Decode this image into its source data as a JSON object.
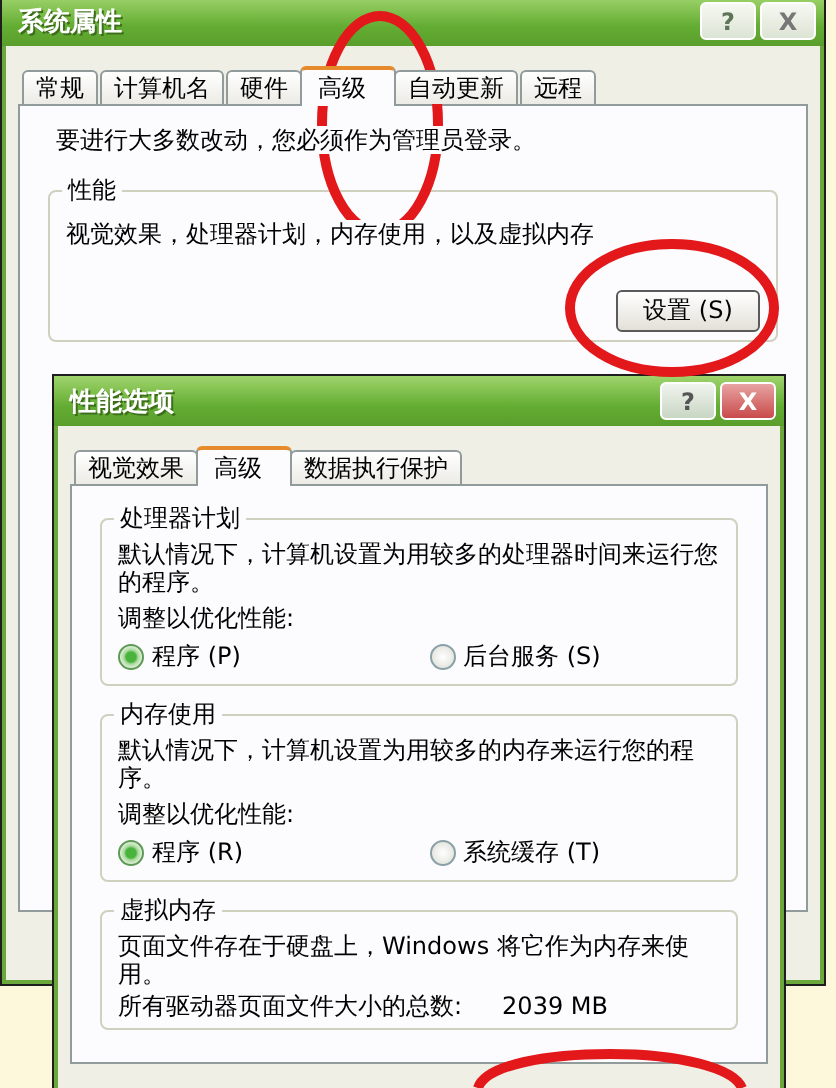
{
  "system_properties": {
    "title": "系统属性",
    "title_buttons": [
      {
        "kind": "help",
        "label": "?"
      },
      {
        "kind": "close",
        "label": "X"
      }
    ],
    "tabs": [
      {
        "label": "常规",
        "selected": false
      },
      {
        "label": "计算机名",
        "selected": false
      },
      {
        "label": "硬件",
        "selected": false
      },
      {
        "label": "高级",
        "selected": true
      },
      {
        "label": "自动更新",
        "selected": false
      },
      {
        "label": "远程",
        "selected": false
      }
    ],
    "notice": "要进行大多数改动，您必须作为管理员登录。",
    "performance": {
      "legend": "性能",
      "description": "视觉效果，处理器计划，内存使用，以及虚拟内存",
      "button": "设置 (S)"
    }
  },
  "performance_options": {
    "title": "性能选项",
    "title_buttons": [
      {
        "kind": "help",
        "label": "?"
      },
      {
        "kind": "close",
        "label": "X"
      }
    ],
    "tabs": [
      {
        "label": "视觉效果",
        "selected": false
      },
      {
        "label": "高级",
        "selected": true
      },
      {
        "label": "数据执行保护",
        "selected": false
      }
    ],
    "groups": [
      {
        "kind": "radios",
        "legend": "处理器计划",
        "description": "默认情况下，计算机设置为用较多的处理器时间来运行您的程序。",
        "prompt": "调整以优化性能:",
        "options": [
          {
            "label": "程序 (P)",
            "selected": true
          },
          {
            "label": "后台服务 (S)",
            "selected": false
          }
        ]
      },
      {
        "kind": "radios",
        "legend": "内存使用",
        "description": "默认情况下，计算机设置为用较多的内存来运行您的程序。",
        "prompt": "调整以优化性能:",
        "options": [
          {
            "label": "程序 (R)",
            "selected": true
          },
          {
            "label": "系统缓存 (T)",
            "selected": false
          }
        ]
      },
      {
        "kind": "info",
        "legend": "虚拟内存",
        "description": "页面文件存在于硬盘上，Windows 将它作为内存来使用。",
        "total_label": "所有驱动器页面文件大小的总数:",
        "total_value": "2039 MB"
      }
    ]
  },
  "annotations": [
    {
      "kind": "ellipse"
    },
    {
      "kind": "ellipse"
    },
    {
      "kind": "arc"
    }
  ]
}
